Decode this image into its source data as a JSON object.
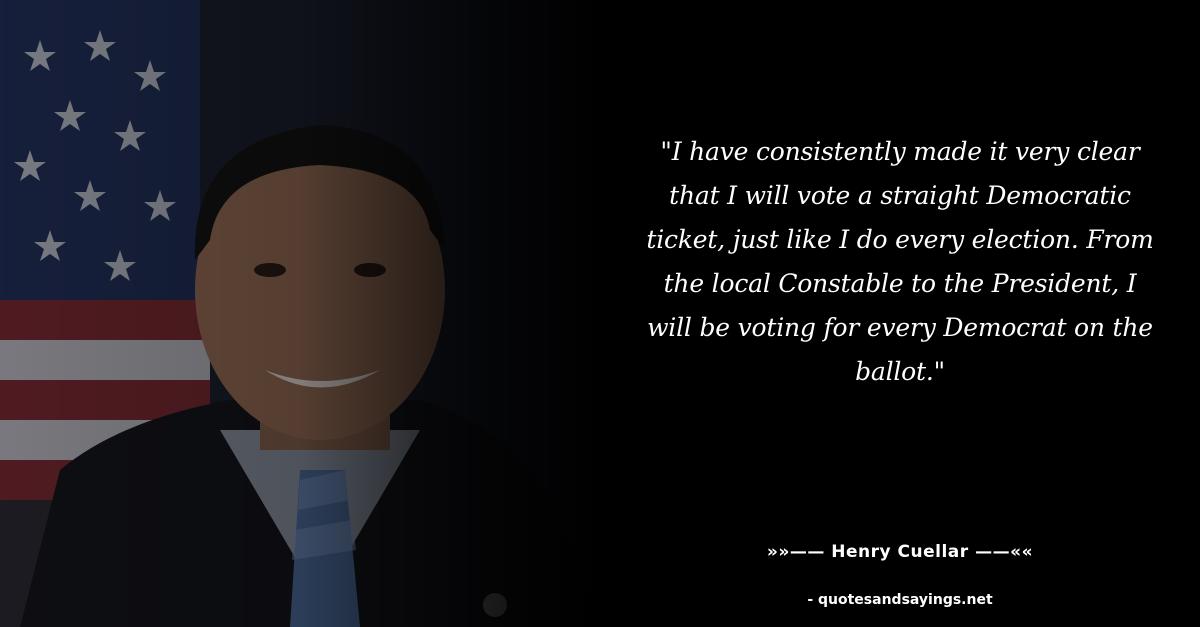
{
  "quote": {
    "text": "\"I have consistently made it very clear that I will vote a straight Democratic ticket, just like I do every election. From the local Constable to the President, I will be voting for every Democrat on the ballot.\""
  },
  "author": {
    "line": "»»—— Henry Cuellar ——««"
  },
  "source": {
    "site": "- quotesandsayings.net"
  },
  "colors": {
    "background": "#000000",
    "text": "#ffffff"
  },
  "photo": {
    "subject": "portrait-with-us-flag"
  }
}
